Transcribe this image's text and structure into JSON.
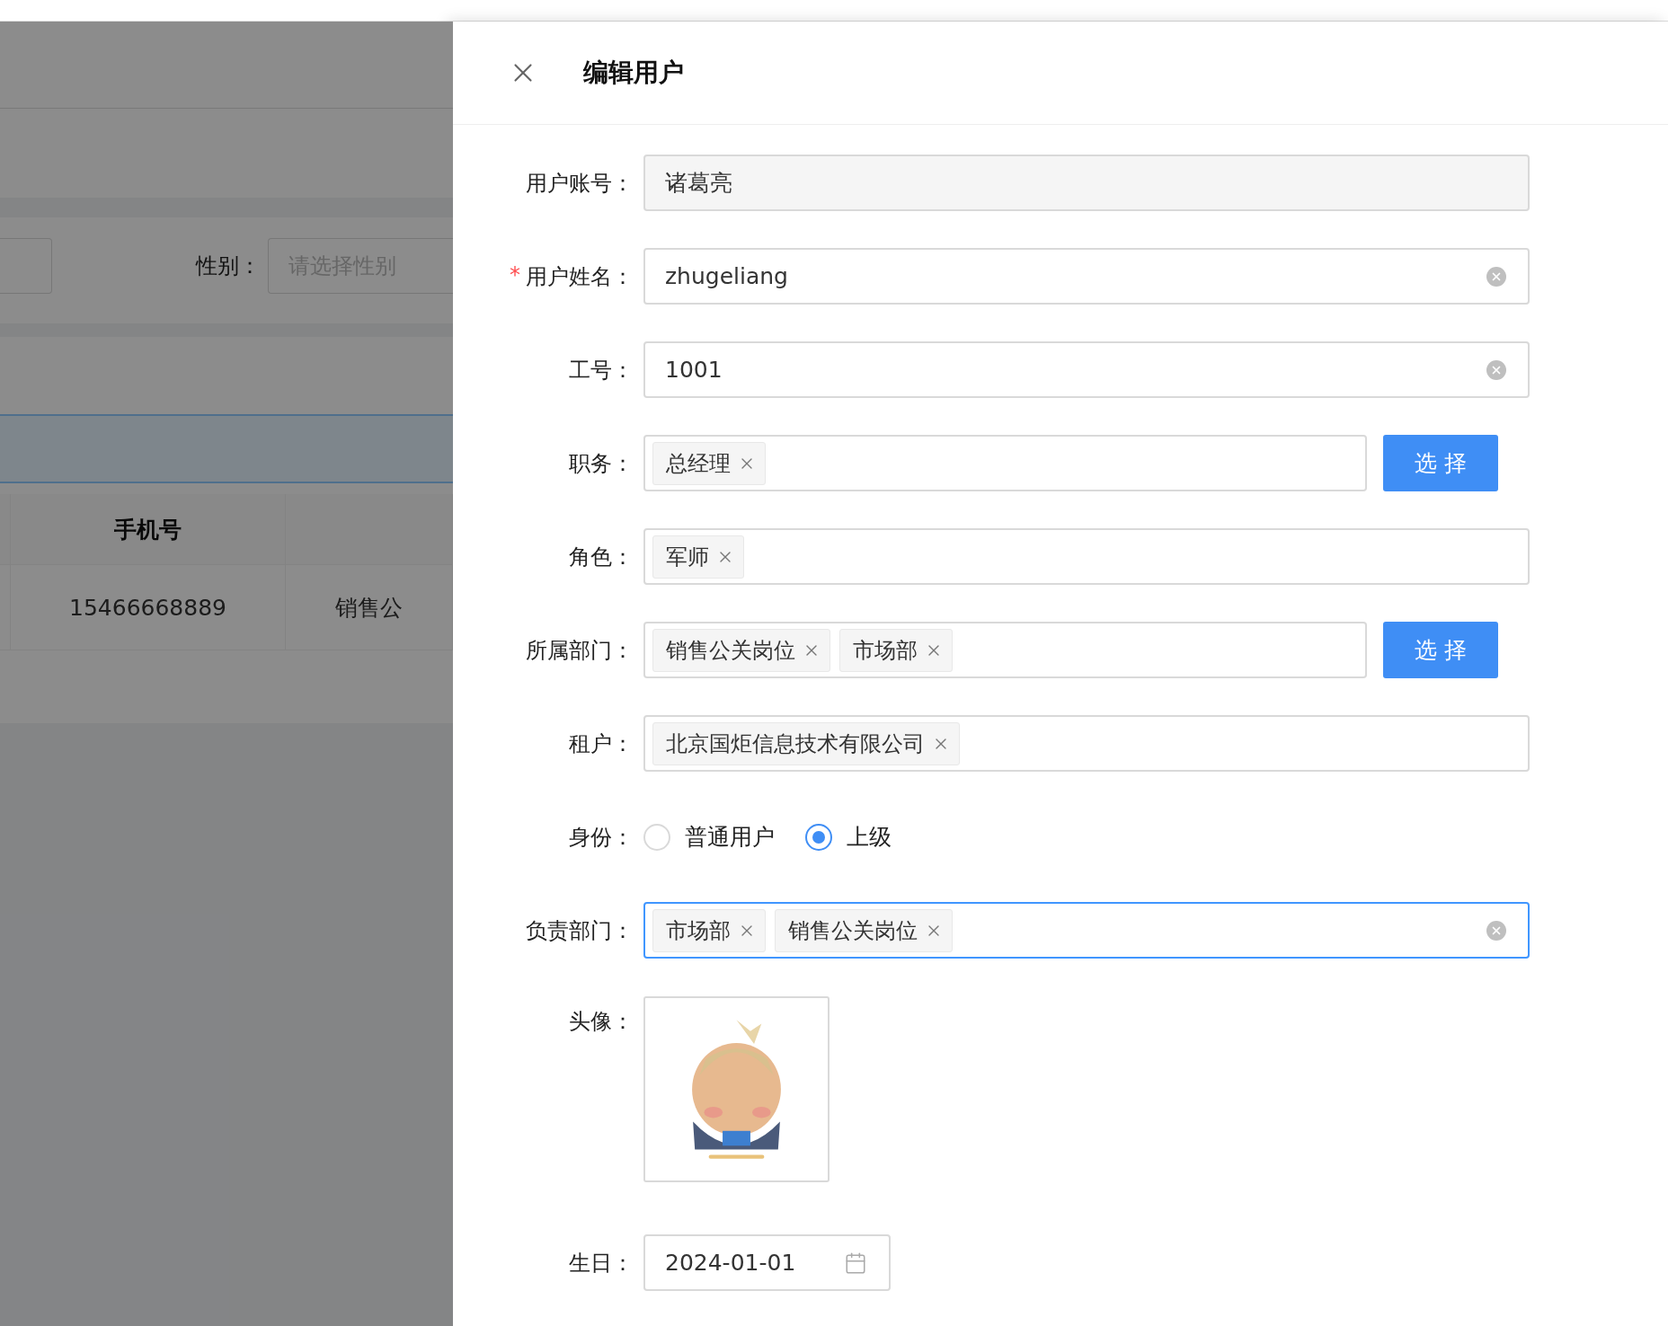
{
  "backdrop": {
    "filter": {
      "label": "性别：",
      "placeholder": "请选择性别"
    },
    "table": {
      "columns": [
        "手机号"
      ],
      "rows": [
        [
          "15466668889",
          "销售公"
        ]
      ]
    }
  },
  "drawer": {
    "title": "编辑用户",
    "required_mark": "*",
    "fields": [
      {
        "kind": "input",
        "label": "用户账号：",
        "value": "诸葛亮",
        "disabled": true
      },
      {
        "kind": "input",
        "label": "用户姓名：",
        "value": "zhugeliang",
        "required": true,
        "clearable": true
      },
      {
        "kind": "input",
        "label": "工号：",
        "value": "1001",
        "clearable": true
      },
      {
        "kind": "tags",
        "label": "职务：",
        "tags": [
          "总经理"
        ],
        "button": "选 择"
      },
      {
        "kind": "tags",
        "label": "角色：",
        "tags": [
          "军师"
        ]
      },
      {
        "kind": "tags",
        "label": "所属部门：",
        "tags": [
          "销售公关岗位",
          "市场部"
        ],
        "button": "选 择"
      },
      {
        "kind": "tags",
        "label": "租户：",
        "tags": [
          "北京国炬信息技术有限公司"
        ]
      },
      {
        "kind": "radio",
        "label": "身份：",
        "options": [
          {
            "label": "普通用户",
            "selected": false
          },
          {
            "label": "上级",
            "selected": true
          }
        ]
      },
      {
        "kind": "tags",
        "label": "负责部门：",
        "tags": [
          "市场部",
          "销售公关岗位"
        ],
        "focused": true,
        "clearable": true
      },
      {
        "kind": "avatar",
        "label": "头像："
      },
      {
        "kind": "date",
        "label": "生日：",
        "value": "2024-01-01"
      }
    ]
  }
}
